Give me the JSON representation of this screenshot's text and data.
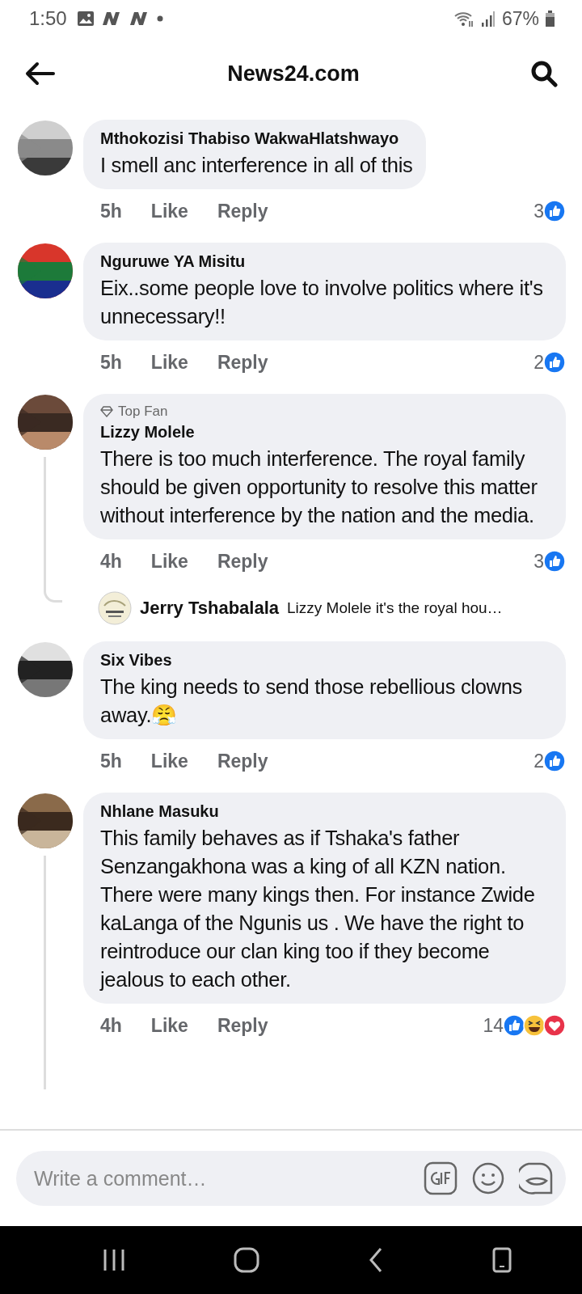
{
  "status_bar": {
    "time": "1:50",
    "battery": "67%"
  },
  "header": {
    "title": "News24.com"
  },
  "comments": [
    {
      "name": "Mthokozisi Thabiso WakwaHlatshwayo",
      "text": "I smell anc interference in all of this",
      "time": "5h",
      "like": "Like",
      "reply": "Reply",
      "count": "3",
      "reactions": [
        {
          "kind": "like"
        }
      ],
      "has_replies": false
    },
    {
      "name": "Nguruwe YA Misitu",
      "text": "Eix..some people love to involve politics where it's unnecessary!!",
      "time": "5h",
      "like": "Like",
      "reply": "Reply",
      "count": "2",
      "reactions": [
        {
          "kind": "like"
        }
      ],
      "has_replies": false
    },
    {
      "name": "Lizzy Molele",
      "badge": "Top Fan",
      "text": "There is too much interference. The royal family should be given opportunity to resolve this matter without interference by the nation and the media.",
      "time": "4h",
      "like": "Like",
      "reply": "Reply",
      "count": "3",
      "reactions": [
        {
          "kind": "like"
        }
      ],
      "has_replies": true,
      "replies": [
        {
          "name": "Jerry Tshabalala",
          "text": "Lizzy Molele it's the royal hou…"
        }
      ]
    },
    {
      "name": "Six Vibes",
      "text": "The king needs to send those rebellious clowns away.😤",
      "time": "5h",
      "like": "Like",
      "reply": "Reply",
      "count": "2",
      "reactions": [
        {
          "kind": "like"
        }
      ],
      "has_replies": false
    },
    {
      "name": "Nhlane Masuku",
      "text": "This family behaves as if Tshaka's father Senzangakhona  was a king of all KZN nation. There were many kings then. For instance Zwide kaLanga of the Ngunis  us . We have the right to reintroduce our clan king too if they become jealous to each other.",
      "time": "4h",
      "like": "Like",
      "reply": "Reply",
      "count": "14",
      "reactions": [
        {
          "kind": "like"
        },
        {
          "kind": "haha"
        },
        {
          "kind": "love"
        }
      ],
      "has_replies": true
    }
  ],
  "composer": {
    "placeholder": "Write a comment…"
  }
}
